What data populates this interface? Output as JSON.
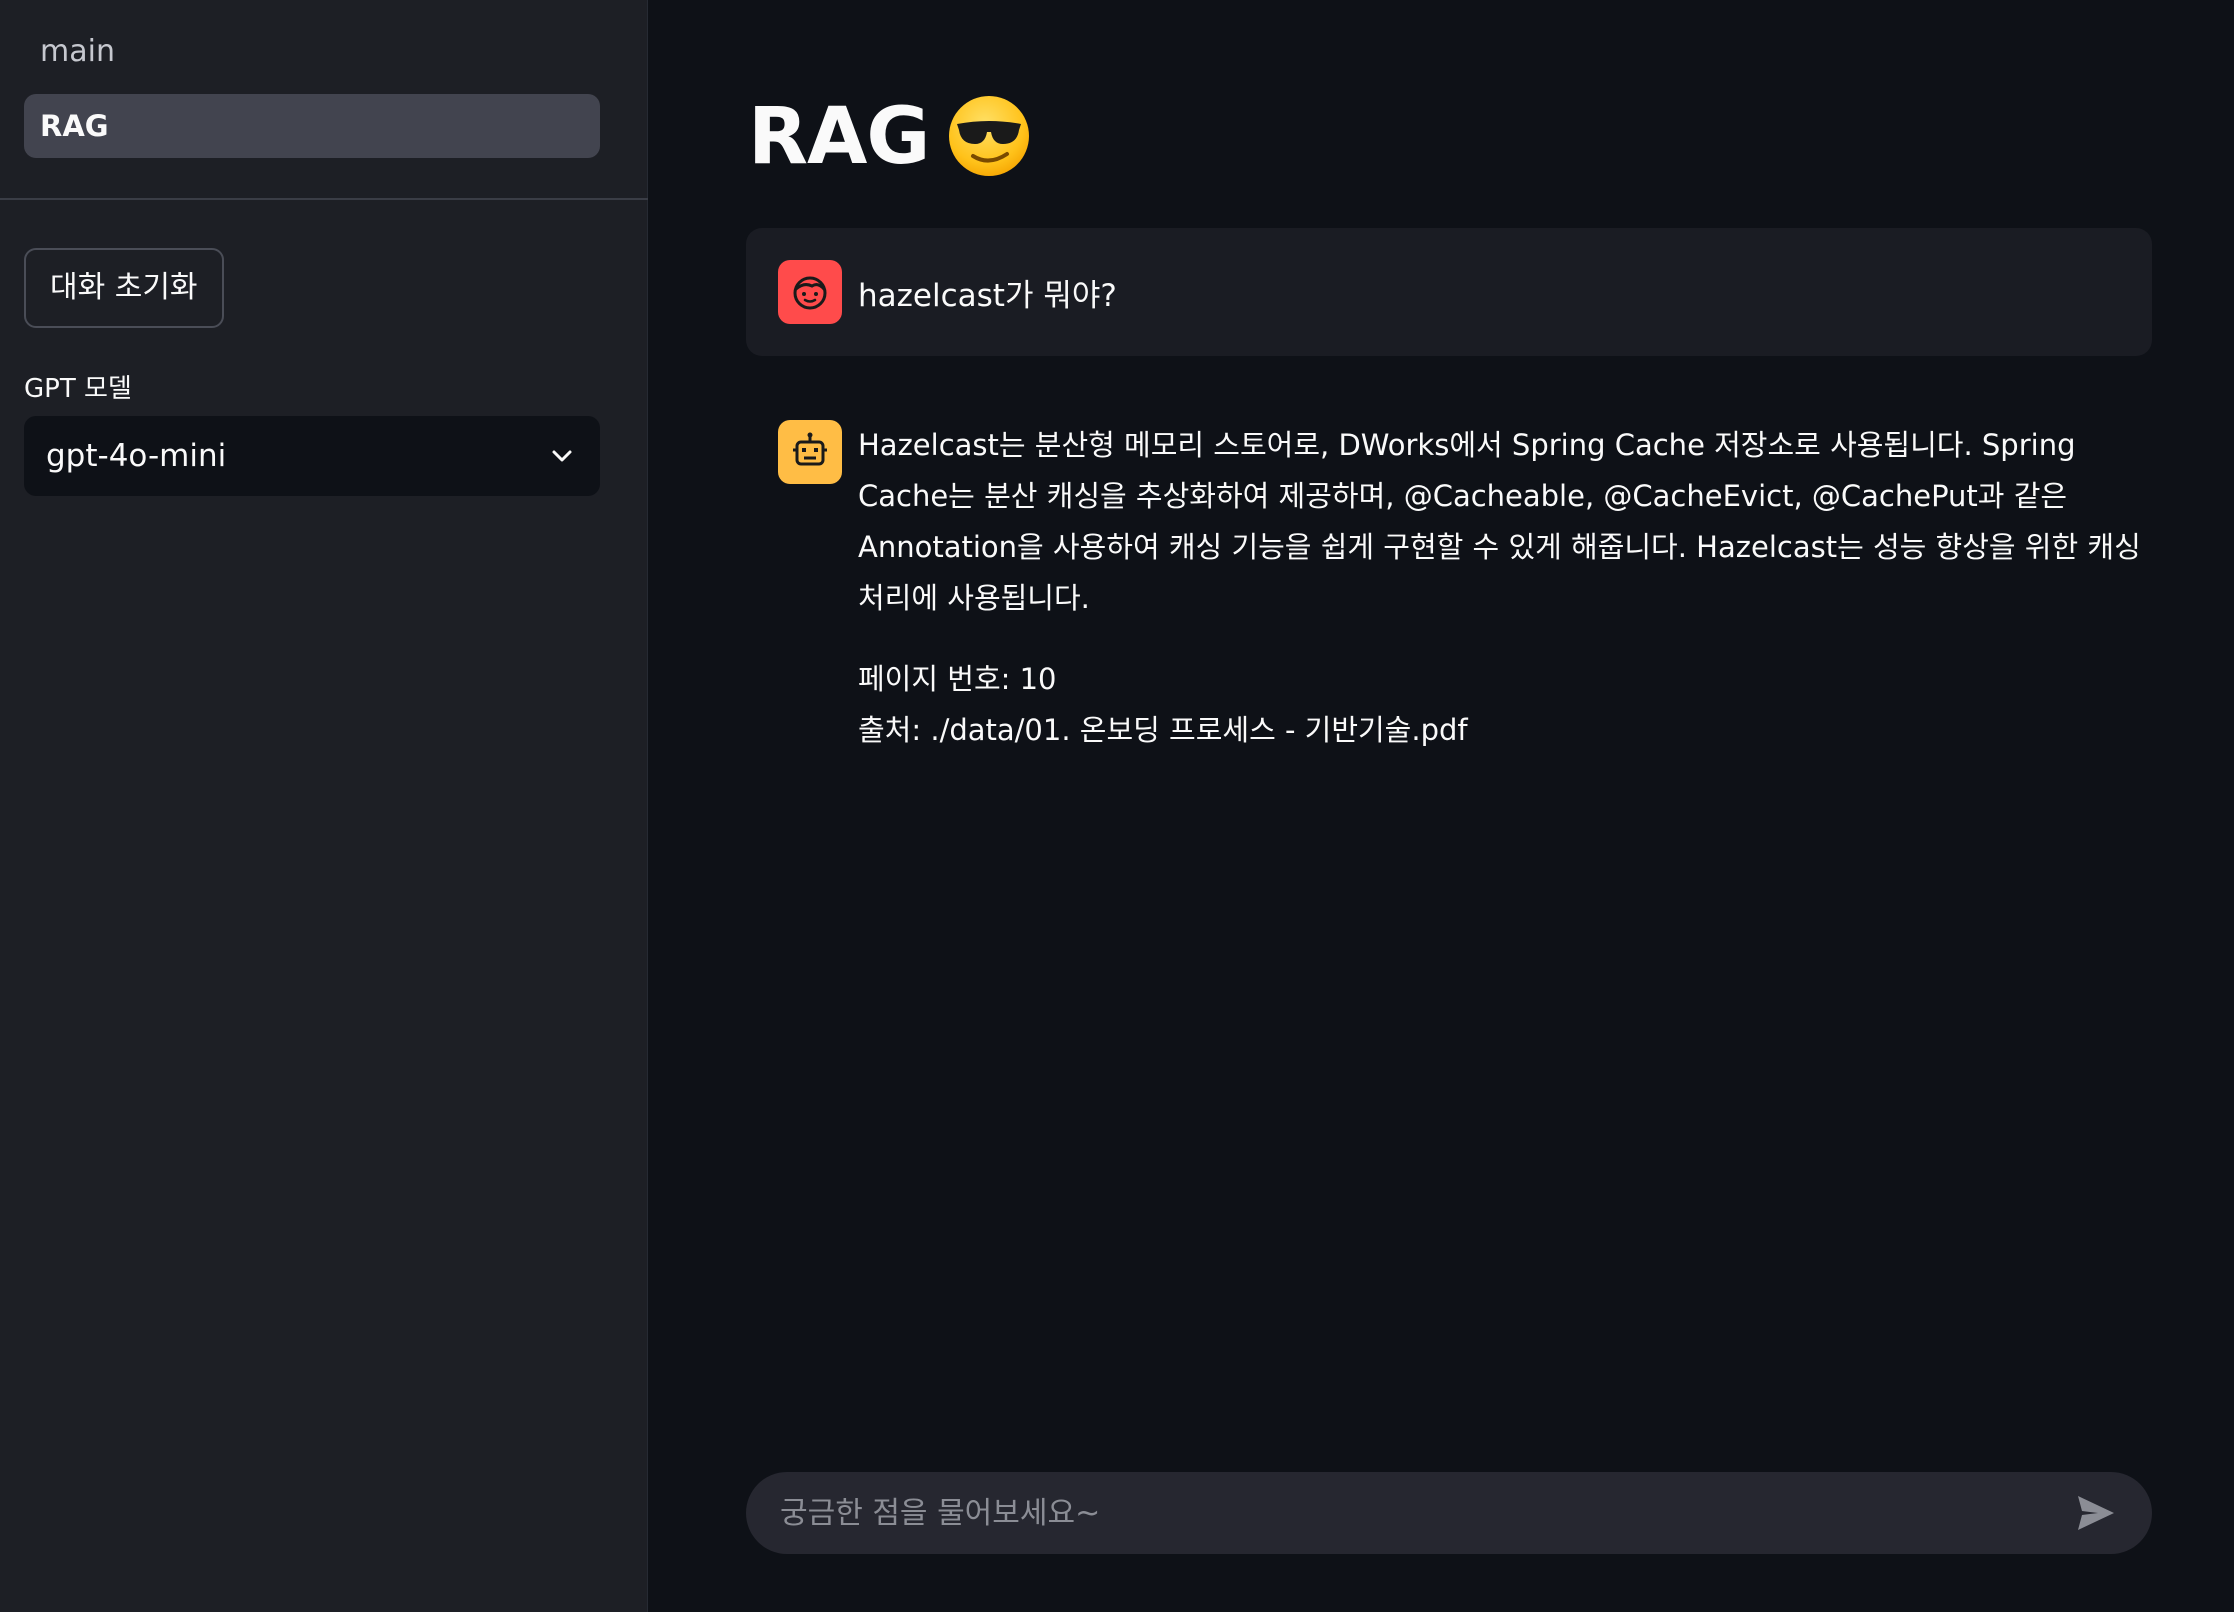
{
  "sidebar": {
    "nav": [
      {
        "label": "main"
      },
      {
        "label": "RAG"
      }
    ],
    "reset_button": "대화 초기화",
    "model_label": "GPT 모델",
    "model_selected": "gpt-4o-mini"
  },
  "page": {
    "title": "RAG",
    "title_emoji": "sunglasses-face-emoji"
  },
  "chat": {
    "messages": [
      {
        "role": "user",
        "avatar_icon": "user-face-icon",
        "text": "hazelcast가 뭐야?"
      },
      {
        "role": "assistant",
        "avatar_icon": "robot-face-icon",
        "text": "Hazelcast는 분산형 메모리 스토어로, DWorks에서 Spring Cache 저장소로 사용됩니다. Spring Cache는 분산 캐싱을 추상화하여 제공하며, @Cacheable, @CacheEvict, @CachePut과 같은 Annotation을 사용하여 캐싱 기능을 쉽게 구현할 수 있게 해줍니다. Hazelcast는 성능 향상을 위한 캐싱 처리에 사용됩니다.",
        "page_line": "페이지 번호: 10",
        "source_line": "출처: ./data/01. 온보딩 프로세스 - 기반기술.pdf"
      }
    ],
    "input_placeholder": "궁금한 점을 물어보세요~"
  },
  "colors": {
    "background": "#0e1117",
    "sidebar": "#1d1f25",
    "user_avatar": "#ff4b4b",
    "bot_avatar": "#ffbd45",
    "input_bg": "#262730"
  }
}
